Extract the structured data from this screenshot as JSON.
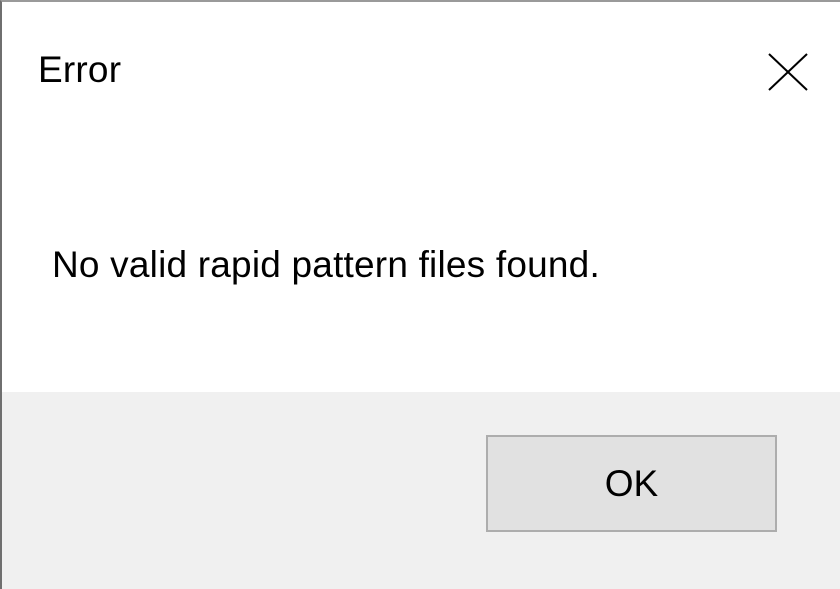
{
  "dialog": {
    "title": "Error",
    "message": "No valid rapid pattern files found.",
    "ok_label": "OK",
    "close_icon": "close-icon"
  },
  "colors": {
    "background": "#ffffff",
    "footer_background": "#f0f0f0",
    "button_face": "#e1e1e1",
    "button_border": "#adadad",
    "text": "#000000"
  }
}
